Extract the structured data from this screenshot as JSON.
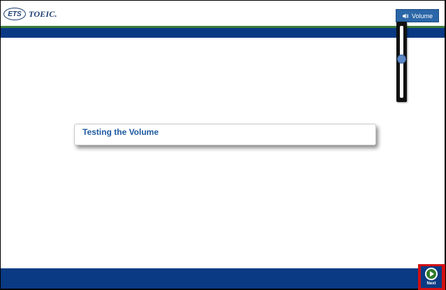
{
  "header": {
    "logo_ets": "ETS",
    "logo_toeic": "TOEIC."
  },
  "volume": {
    "button_label": "Volume",
    "level": 0.55
  },
  "main": {
    "card_title": "Testing the Volume"
  },
  "footer": {
    "next_label": "Next"
  },
  "colors": {
    "brand_blue": "#0a3a83",
    "accent_green": "#3d7f3a",
    "button_blue": "#2b67a8",
    "highlight_red": "#d20f12",
    "title_blue": "#1f5aa0"
  },
  "icons": {
    "volume": "speaker-icon",
    "next": "play-circle-icon"
  }
}
